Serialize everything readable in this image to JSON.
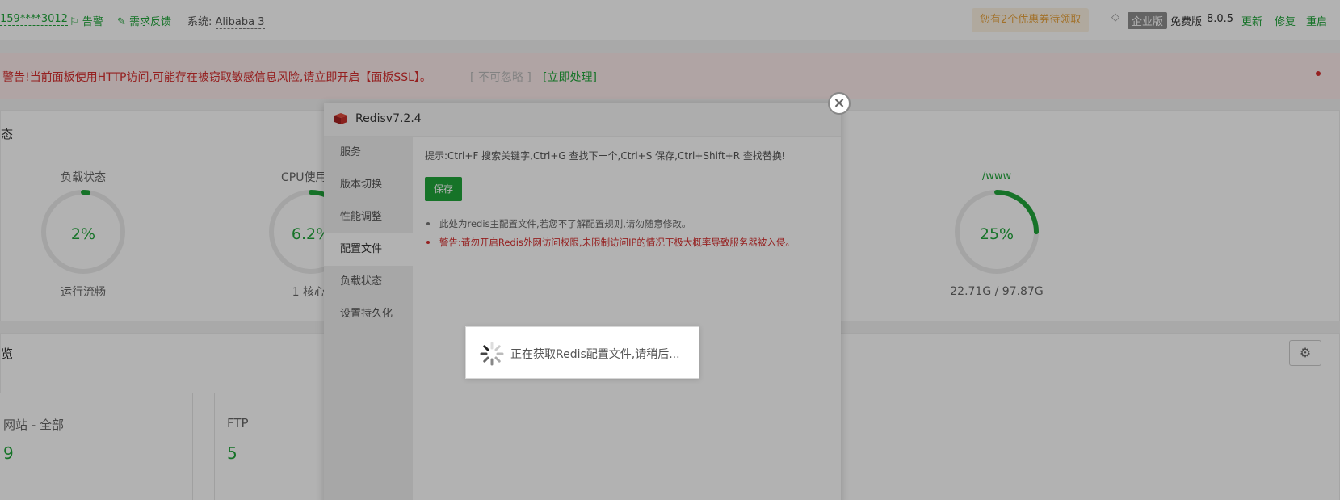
{
  "topbar": {
    "ip": "159****3012",
    "alarm": "告警",
    "feedback": "需求反馈",
    "system_label": "系统:",
    "system_value": "Alibaba 3",
    "coupon": "您有2个优惠券待领取",
    "enterprise": "企业版",
    "free": "免费版",
    "version": "8.0.5",
    "update": "更新",
    "repair": "修复",
    "restart": "重启"
  },
  "warning": {
    "text": "警告!当前面板使用HTTP访问,可能存在被窃取敏感信息风险,请立即开启【面板SSL】。",
    "ignore": "[ 不可忽略 ]",
    "handle": "[立即处理]"
  },
  "status": {
    "title": "态",
    "gauges": [
      {
        "label": "负载状态",
        "value": "2%",
        "sub": "运行流畅",
        "percent": 2
      },
      {
        "label": "CPU使用",
        "value": "6.2%",
        "sub": "1 核心",
        "percent": 6.2
      },
      {
        "label": "/www",
        "value": "25%",
        "sub": "22.71G / 97.87G",
        "percent": 25
      }
    ]
  },
  "overview": {
    "title": "览",
    "boxes": [
      {
        "label": "网站 - 全部",
        "value": "9"
      },
      {
        "label": "FTP",
        "value": "5"
      }
    ]
  },
  "modal": {
    "title": "Redisv7.2.4",
    "menu": [
      "服务",
      "版本切换",
      "性能调整",
      "配置文件",
      "负载状态",
      "设置持久化"
    ],
    "active_index": 3,
    "tip": "提示:Ctrl+F 搜索关键字,Ctrl+G 查找下一个,Ctrl+S 保存,Ctrl+Shift+R 查找替换!",
    "save": "保存",
    "notes": [
      "此处为redis主配置文件,若您不了解配置规则,请勿随意修改。",
      "警告:请勿开启Redis外网访问权限,未限制访问IP的情况下极大概率导致服务器被入侵。"
    ],
    "close_symbol": "×"
  },
  "loading": {
    "text": "正在获取Redis配置文件,请稍后..."
  },
  "colors": {
    "accent": "#20a53a",
    "danger": "#d62e2e",
    "coupon": "#e8a33d"
  }
}
